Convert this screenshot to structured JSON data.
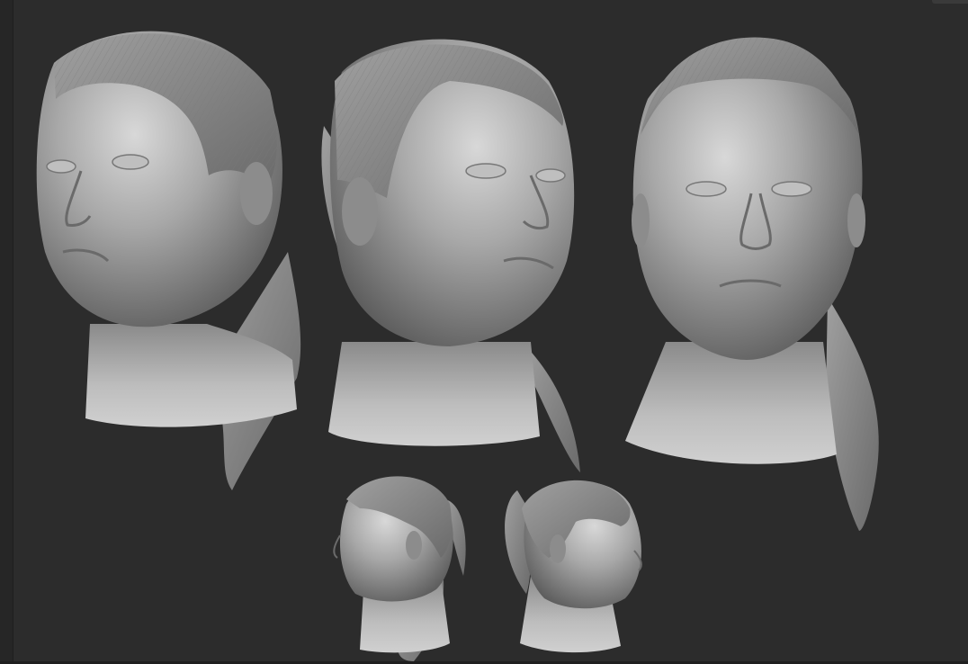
{
  "app": {
    "viewport_background": "#2c2c2c",
    "material_color": "#9a9a9a"
  },
  "views": [
    {
      "label": "three-quarter-left"
    },
    {
      "label": "three-quarter-right"
    },
    {
      "label": "front"
    },
    {
      "label": "profile-left"
    },
    {
      "label": "back-three-quarter-right"
    }
  ]
}
